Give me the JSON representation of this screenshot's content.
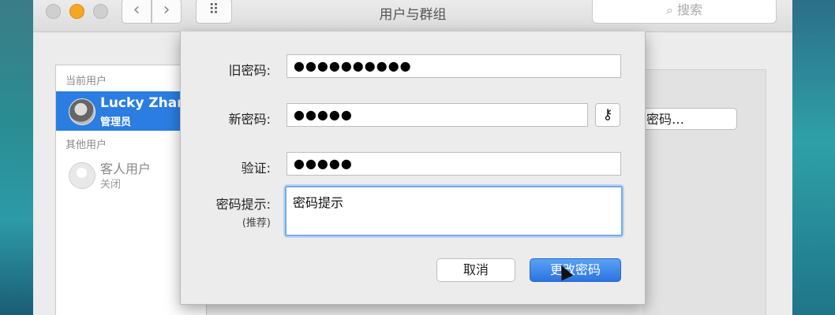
{
  "window": {
    "title": "用户与群组",
    "search_placeholder": "搜索",
    "nav_back": "‹",
    "nav_forward": "›",
    "grid": "⠿"
  },
  "sidebar": {
    "current_users_header": "当前用户",
    "current_user": {
      "name": "Lucky Zhan",
      "role": "管理员"
    },
    "other_users_header": "其他用户",
    "guest": {
      "name": "客人用户",
      "status": "关闭"
    }
  },
  "pane": {
    "button_label": "密码…"
  },
  "dialog": {
    "old_password_label": "旧密码:",
    "old_password_value": "●●●●●●●●●●",
    "new_password_label": "新密码:",
    "new_password_value": "●●●●●",
    "verify_label": "验证:",
    "verify_value": "●●●●●",
    "hint_label": "密码提示:",
    "hint_sub_label": "(推荐)",
    "hint_value": "密码提示",
    "cancel_label": "取消",
    "change_label": "更改密码"
  },
  "colors": {
    "accent": "#2b7de2",
    "minimize": "#f5a623"
  }
}
